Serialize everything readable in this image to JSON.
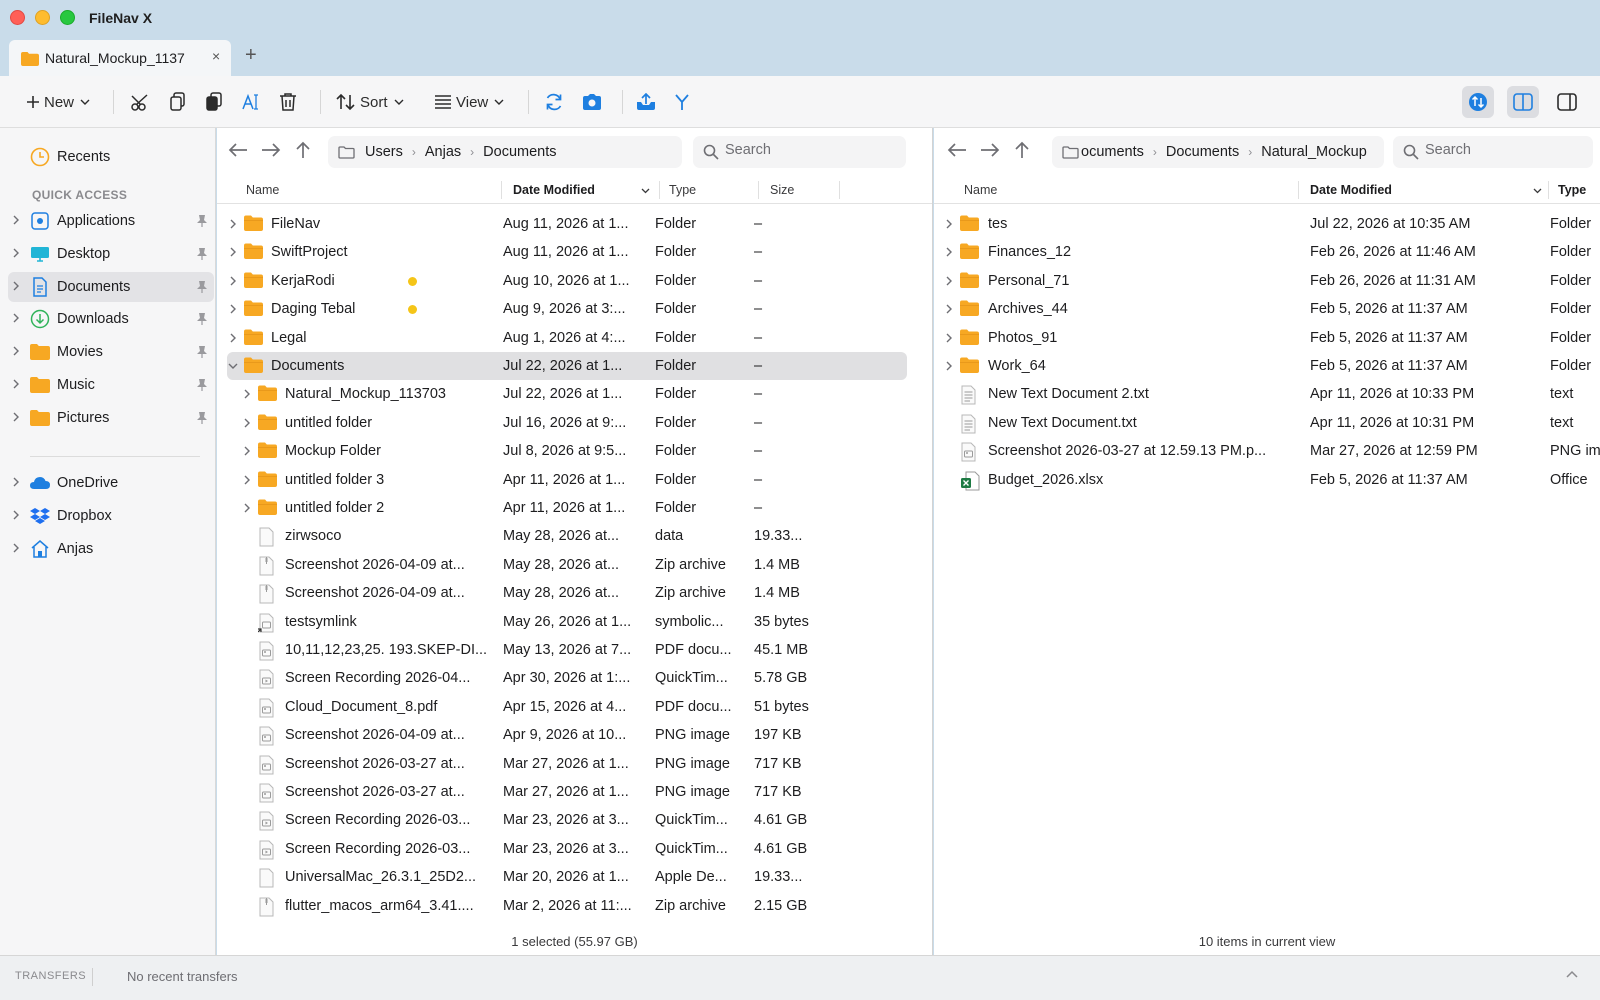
{
  "app": {
    "title": "FileNav X"
  },
  "tabs": [
    {
      "label": "Natural_Mockup_1137...",
      "close": "×"
    }
  ],
  "tab_add": "+",
  "toolbar": {
    "new_label": "New",
    "sort_label": "Sort",
    "view_label": "View"
  },
  "sidebar": {
    "recents": "Recents",
    "section_quick_access": "QUICK ACCESS",
    "quick_access": [
      {
        "label": "Applications",
        "icon": "applications-icon"
      },
      {
        "label": "Desktop",
        "icon": "desktop-icon"
      },
      {
        "label": "Documents",
        "icon": "documents-icon"
      },
      {
        "label": "Downloads",
        "icon": "downloads-icon"
      },
      {
        "label": "Movies",
        "icon": "folder-icon"
      },
      {
        "label": "Music",
        "icon": "folder-icon"
      },
      {
        "label": "Pictures",
        "icon": "folder-icon"
      }
    ],
    "locations": [
      {
        "label": "OneDrive",
        "icon": "onedrive-icon"
      },
      {
        "label": "Dropbox",
        "icon": "dropbox-icon"
      },
      {
        "label": "Anjas",
        "icon": "home-icon"
      }
    ]
  },
  "left_pane": {
    "breadcrumb": [
      "Users",
      "Anjas",
      "Documents"
    ],
    "search_placeholder": "Search",
    "columns": {
      "name": "Name",
      "date": "Date Modified",
      "type": "Type",
      "size": "Size"
    },
    "rows": [
      {
        "name": "FileNav",
        "date": "Aug 11, 2026 at 1...",
        "type": "Folder",
        "size": "–",
        "kind": "folder",
        "level": 0,
        "expand": "collapsed"
      },
      {
        "name": "SwiftProject",
        "date": "Aug 11, 2026 at 1...",
        "type": "Folder",
        "size": "–",
        "kind": "folder",
        "level": 0,
        "expand": "collapsed"
      },
      {
        "name": "KerjaRodi",
        "date": "Aug 10, 2026 at 1...",
        "type": "Folder",
        "size": "–",
        "kind": "folder",
        "level": 0,
        "expand": "collapsed",
        "tag": "#f5c518"
      },
      {
        "name": "Daging Tebal",
        "date": "Aug 9, 2026 at 3:...",
        "type": "Folder",
        "size": "–",
        "kind": "folder",
        "level": 0,
        "expand": "collapsed",
        "tag": "#f5c518"
      },
      {
        "name": "Legal",
        "date": "Aug 1, 2026 at 4:...",
        "type": "Folder",
        "size": "–",
        "kind": "folder",
        "level": 0,
        "expand": "collapsed"
      },
      {
        "name": "Documents",
        "date": "Jul 22, 2026 at 1...",
        "type": "Folder",
        "size": "–",
        "kind": "folder",
        "level": 0,
        "expand": "expanded",
        "selected": true
      },
      {
        "name": "Natural_Mockup_113703",
        "date": "Jul 22, 2026 at 1...",
        "type": "Folder",
        "size": "–",
        "kind": "folder",
        "level": 1,
        "expand": "collapsed"
      },
      {
        "name": "untitled folder",
        "date": "Jul 16, 2026 at 9:...",
        "type": "Folder",
        "size": "–",
        "kind": "folder",
        "level": 1,
        "expand": "collapsed"
      },
      {
        "name": "Mockup Folder",
        "date": "Jul 8, 2026 at 9:5...",
        "type": "Folder",
        "size": "–",
        "kind": "folder",
        "level": 1,
        "expand": "collapsed"
      },
      {
        "name": "untitled folder 3",
        "date": "Apr 11, 2026 at 1...",
        "type": "Folder",
        "size": "–",
        "kind": "folder",
        "level": 1,
        "expand": "collapsed"
      },
      {
        "name": "untitled folder 2",
        "date": "Apr 11, 2026 at 1...",
        "type": "Folder",
        "size": "–",
        "kind": "folder",
        "level": 1,
        "expand": "collapsed"
      },
      {
        "name": "zirwsoco",
        "date": "May 28, 2026 at...",
        "type": "data",
        "size": "19.33...",
        "kind": "file",
        "level": 1
      },
      {
        "name": "Screenshot 2026-04-09 at...",
        "date": "May 28, 2026 at...",
        "type": "Zip archive",
        "size": "1.4 MB",
        "kind": "zip",
        "level": 1
      },
      {
        "name": "Screenshot 2026-04-09 at...",
        "date": "May 28, 2026 at...",
        "type": "Zip archive",
        "size": "1.4 MB",
        "kind": "zip",
        "level": 1
      },
      {
        "name": "testsymlink",
        "date": "May 26, 2026 at 1...",
        "type": "symbolic...",
        "size": "35 bytes",
        "kind": "symlink",
        "level": 1
      },
      {
        "name": "10,11,12,23,25. 193.SKEP-DI...",
        "date": "May 13, 2026 at 7...",
        "type": "PDF docu...",
        "size": "45.1 MB",
        "kind": "image",
        "level": 1
      },
      {
        "name": "Screen Recording 2026-04...",
        "date": "Apr 30, 2026 at 1:...",
        "type": "QuickTim...",
        "size": "5.78 GB",
        "kind": "video",
        "level": 1
      },
      {
        "name": "Cloud_Document_8.pdf",
        "date": "Apr 15, 2026 at 4...",
        "type": "PDF docu...",
        "size": "51 bytes",
        "kind": "image",
        "level": 1
      },
      {
        "name": "Screenshot 2026-04-09 at...",
        "date": "Apr 9, 2026 at 10...",
        "type": "PNG image",
        "size": "197 KB",
        "kind": "image",
        "level": 1
      },
      {
        "name": "Screenshot 2026-03-27 at...",
        "date": "Mar 27, 2026 at 1...",
        "type": "PNG image",
        "size": "717 KB",
        "kind": "image",
        "level": 1
      },
      {
        "name": "Screenshot 2026-03-27 at...",
        "date": "Mar 27, 2026 at 1...",
        "type": "PNG image",
        "size": "717 KB",
        "kind": "image",
        "level": 1
      },
      {
        "name": "Screen Recording 2026-03...",
        "date": "Mar 23, 2026 at 3...",
        "type": "QuickTim...",
        "size": "4.61 GB",
        "kind": "video",
        "level": 1
      },
      {
        "name": "Screen Recording 2026-03...",
        "date": "Mar 23, 2026 at 3...",
        "type": "QuickTim...",
        "size": "4.61 GB",
        "kind": "video",
        "level": 1
      },
      {
        "name": "UniversalMac_26.3.1_25D2...",
        "date": "Mar 20, 2026 at 1...",
        "type": "Apple De...",
        "size": "19.33...",
        "kind": "file",
        "level": 1
      },
      {
        "name": "flutter_macos_arm64_3.41....",
        "date": "Mar 2, 2026 at 11:...",
        "type": "Zip archive",
        "size": "2.15 GB",
        "kind": "zip",
        "level": 1
      }
    ],
    "footer": "1 selected (55.97 GB)"
  },
  "right_pane": {
    "breadcrumb": [
      "ocuments",
      "Documents",
      "Natural_Mockup"
    ],
    "search_placeholder": "Search",
    "columns": {
      "name": "Name",
      "date": "Date Modified",
      "type": "Type"
    },
    "rows": [
      {
        "name": "tes",
        "date": "Jul 22, 2026 at 10:35 AM",
        "type": "Folder",
        "kind": "folder",
        "expand": "collapsed"
      },
      {
        "name": "Finances_12",
        "date": "Feb 26, 2026 at 11:46 AM",
        "type": "Folder",
        "kind": "folder",
        "expand": "collapsed"
      },
      {
        "name": "Personal_71",
        "date": "Feb 26, 2026 at 11:31 AM",
        "type": "Folder",
        "kind": "folder",
        "expand": "collapsed"
      },
      {
        "name": "Archives_44",
        "date": "Feb 5, 2026 at 11:37 AM",
        "type": "Folder",
        "kind": "folder",
        "expand": "collapsed"
      },
      {
        "name": "Photos_91",
        "date": "Feb 5, 2026 at 11:37 AM",
        "type": "Folder",
        "kind": "folder",
        "expand": "collapsed"
      },
      {
        "name": "Work_64",
        "date": "Feb 5, 2026 at 11:37 AM",
        "type": "Folder",
        "kind": "folder",
        "expand": "collapsed"
      },
      {
        "name": "New Text Document 2.txt",
        "date": "Apr 11, 2026 at 10:33 PM",
        "type": "text",
        "kind": "text"
      },
      {
        "name": "New Text Document.txt",
        "date": "Apr 11, 2026 at 10:31 PM",
        "type": "text",
        "kind": "text"
      },
      {
        "name": "Screenshot 2026-03-27 at 12.59.13 PM.p...",
        "date": "Mar 27, 2026 at 12:59 PM",
        "type": "PNG im",
        "kind": "image"
      },
      {
        "name": "Budget_2026.xlsx",
        "date": "Feb 5, 2026 at 11:37 AM",
        "type": "Office",
        "kind": "excel"
      }
    ],
    "footer": "10 items in current view"
  },
  "transfers": {
    "label": "TRANSFERS",
    "status": "No recent transfers"
  },
  "colors": {
    "folder": "#f7a823",
    "accent": "#1e7fe0",
    "tag_yellow": "#f5c518",
    "selection": "#e0e0e2"
  }
}
